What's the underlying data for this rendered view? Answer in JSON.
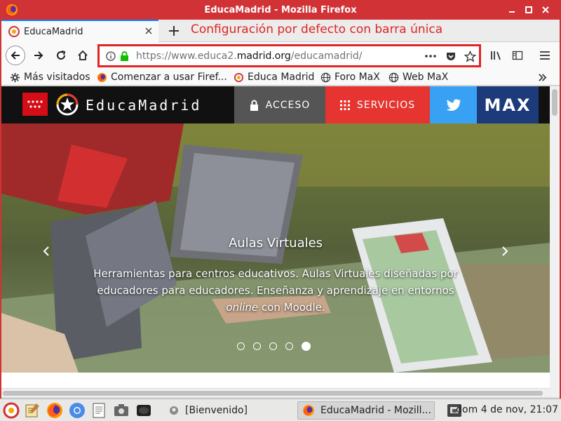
{
  "window": {
    "title": "EducaMadrid - Mozilla Firefox"
  },
  "tab": {
    "label": "EducaMadrid"
  },
  "annotation": "Configuración por defecto con barra única",
  "urlbar": {
    "url_prefix": "https://www.educa2.",
    "url_domain": "madrid.org",
    "url_path": "/educamadrid/"
  },
  "bookmarks": {
    "items": [
      {
        "label": "Más visitados",
        "icon": "gear-icon"
      },
      {
        "label": "Comenzar a usar Firef...",
        "icon": "firefox-icon"
      },
      {
        "label": "Educa Madrid",
        "icon": "educamadrid-icon"
      },
      {
        "label": "Foro MaX",
        "icon": "globe-icon"
      },
      {
        "label": "Web MaX",
        "icon": "globe-icon"
      }
    ]
  },
  "site": {
    "logo_text": "EducaMadrid",
    "nav": {
      "acceso": "ACCESO",
      "servicios": "SERVICIOS",
      "max": "MAX"
    },
    "hero": {
      "title": "Aulas Virtuales",
      "desc_part1": "Herramientas para centros educativos. Aulas Virtuales diseñadas por educadores para educadores. Enseñanza y aprendizaje en entornos ",
      "desc_em": "online",
      "desc_part2": " con Moodle.",
      "slides_total": 5,
      "slide_active": 5
    }
  },
  "taskbar": {
    "task_welcome": "[Bienvenido]",
    "task_firefox": "EducaMadrid - Mozill...",
    "clock": "dom  4 de nov, 21:07"
  },
  "colors": {
    "titlebar": "#d03236",
    "annotation": "#e02424",
    "servicios": "#e63430",
    "twitter": "#38a1f3",
    "max": "#1d3a7a"
  }
}
